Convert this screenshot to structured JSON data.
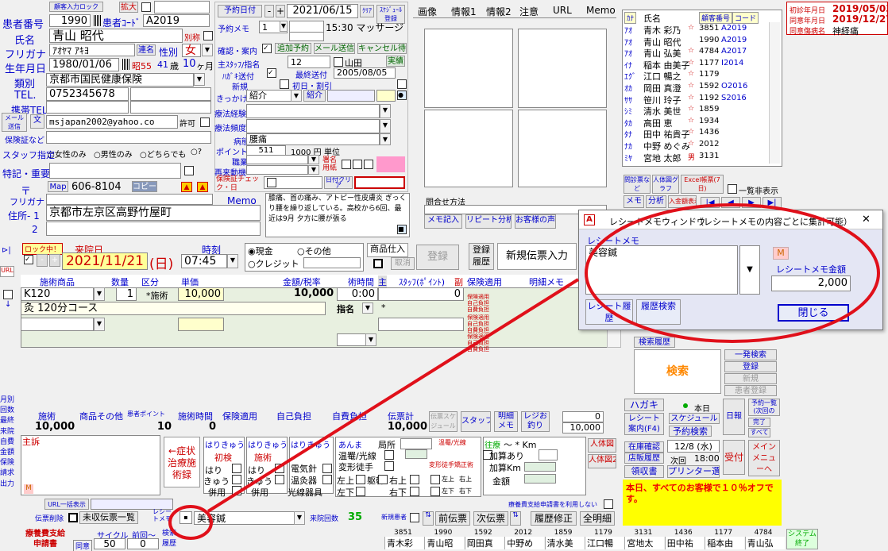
{
  "patient": {
    "lock_btn": "顧客入力ロック",
    "expand_btn": "拡大",
    "id_label": "患者番号",
    "id_value": "1990",
    "code_label": "患者ｺｰﾄﾞ",
    "code_value": "A2019",
    "name_label": "氏名",
    "name_value": "青山 昭代",
    "alias_label": "別称",
    "kana_label": "フリガナ",
    "kana_value": "ｱｵﾔﾏ ｱｷﾖ",
    "kana_btn": "連名",
    "sex_label": "性別",
    "sex_value": "女",
    "birth_label": "生年月日",
    "birth_value": "1980/01/06",
    "era_value": "昭55",
    "age_value": "41",
    "age_unit": "歳",
    "month_value": "10",
    "month_unit": "ヶ月",
    "category_label": "類別",
    "category_value": "京都市国民健康保険",
    "tel_label": "TEL.",
    "tel_value": "0752345678",
    "mobile_label": "携帯TEL",
    "mail_btn": "メール送信",
    "mail_btn2": "文",
    "email_value": "msjapan2002@yahoo.co",
    "permit_label": "許可",
    "insurance_label": "保険証など",
    "staff_label": "スタッフ指定",
    "staff_opt1": "女性のみ",
    "staff_opt2": "男性のみ",
    "staff_opt3": "どちらでも",
    "staff_opt4": "?",
    "notes_label": "特記・重要",
    "zip_label": "〒",
    "map_btn": "Map",
    "zip_value": "606-8104",
    "copy_btn": "コピー",
    "kana2_label": "フリガナ",
    "memo_label": "Memo",
    "addr1_label": "住所- 1",
    "addr1_value": "京都市左京区高野竹屋町",
    "addr2_label": "2"
  },
  "appt": {
    "date_btn": "予約日付",
    "minus": "-",
    "plus": "+",
    "date_value": "2021/06/15",
    "clear_btn": "ｸﾘｱ",
    "schedule_btn": "ｽｹｼﾞｭｰﾙ登録",
    "memo_label": "予約メモ",
    "memo_num": "1",
    "memo_text": "15:30 マッサージ",
    "confirm_label": "確認・案内",
    "mail_add_btn": "追加予約",
    "mail_send_btn": "メール送信",
    "cancel_btn": "キャンセル待",
    "main_staff_label": "主ｽﾀｯﾌ/指名",
    "main_staff_value": "12",
    "staff_name": "山田",
    "done_btn": "実績",
    "hagaki_label": "ﾊｶﾞｷ送付",
    "last_visit_label": "最終送付",
    "new_label": "新規",
    "last_visit_value": "2005/08/05",
    "first_label": "初日・割引",
    "trigger_label": "きっかけ",
    "trigger_value": "紹介",
    "intro_label": "紹介",
    "history_label": "療法経験",
    "freq_label": "療法頻度",
    "disease_label": "病態",
    "disease_value": "腰痛",
    "point_label": "ポイント",
    "point_value": "511",
    "point_yen": "1000 円",
    "point_unit": "単位",
    "job_label": "職業",
    "motive_label": "再来動機",
    "sign_label": "署名用紙",
    "insurance_check_label": "保険証チェック・日",
    "clear2_btn": "日付クリア",
    "memo_body": "膝痛、首の痛み、アトピー性皮膚炎 ぎっくり腰を繰り返している。高校から6回、最近は9月 夕方に腰が張る"
  },
  "tabs": [
    "画像",
    "情報1",
    "情報2",
    "注意",
    "URL",
    "Memo"
  ],
  "media": {
    "consult_label": "問合せ方法",
    "memo_btn": "メモ記入",
    "repeat_btn": "リピート分析",
    "voice_btn": "お客様の声"
  },
  "customer_list": {
    "kana_hdr": "ｶﾅ",
    "name_hdr": "氏名",
    "id_hdr": "顧客番号",
    "code_hdr": "コード",
    "rows": [
      {
        "kana": "ｱｵ",
        "name": "青木 彩乃",
        "star": "☆",
        "id": "3851",
        "code": "A2019"
      },
      {
        "kana": "ｱｵ",
        "name": "青山 昭代",
        "star": "",
        "id": "1990",
        "code": "A2019"
      },
      {
        "kana": "ｱｵ",
        "name": "青山 弘美",
        "star": "☆",
        "id": "4784",
        "code": "A2017"
      },
      {
        "kana": "ｲﾅ",
        "name": "稲本 由美子",
        "star": "☆",
        "id": "1177",
        "code": "I2014"
      },
      {
        "kana": "ｴｸﾞ",
        "name": "江口 暢之",
        "star": "☆",
        "id": "1179",
        "code": ""
      },
      {
        "kana": "ｵｶ",
        "name": "岡田 真澄",
        "star": "☆",
        "id": "1592",
        "code": "O2016"
      },
      {
        "kana": "ｻｻ",
        "name": "笹川 玲子",
        "star": "☆",
        "id": "1192",
        "code": "S2016"
      },
      {
        "kana": "ｼﾐ",
        "name": "清水 美世",
        "star": "☆",
        "id": "1859",
        "code": ""
      },
      {
        "kana": "ﾀｶ",
        "name": "高田 恵",
        "star": "☆",
        "id": "1934",
        "code": ""
      },
      {
        "kana": "ﾀﾅ",
        "name": "田中 祐貴子",
        "star": "☆",
        "id": "1436",
        "code": ""
      },
      {
        "kana": "ﾅｶ",
        "name": "中野 めぐみ",
        "star": "☆",
        "id": "2012",
        "code": ""
      },
      {
        "kana": "ﾐﾔ",
        "name": "宮地 太郎",
        "star": "男",
        "id": "3131",
        "code": ""
      }
    ]
  },
  "dates": {
    "first_label": "初診年月日",
    "first_value": "2019/05/03",
    "last_label": "同意年月日",
    "last_value": "2019/12/27",
    "consent_label": "同意傷病名",
    "consent_value": "神経痛"
  },
  "right_btns": {
    "symptom_btn": "問診票など",
    "body_btn": "人体図グラフ",
    "excel_btn": "Excel帳票(7日)",
    "list_label": "一覧非表示",
    "memo_btn": "メモ",
    "analysis_btn": "分析",
    "card_btn": "入金額表示",
    "nav_icons": [
      "|◀",
      "◀",
      "▶",
      "▶|"
    ]
  },
  "visit": {
    "lock_label": "ロック中！",
    "date_label": "来院日",
    "date_value": "2021/11/21",
    "dow": "(日)",
    "time_label": "時刻",
    "time_value": "07:45",
    "pay_cash": "現金",
    "pay_other": "その他",
    "pay_credit": "クレジット",
    "goods_btn": "商品仕入",
    "cancel_btn": "取消",
    "register_btn": "登録",
    "reg_history_btn": "登録履歴",
    "new_slip_btn": "新規伝票入力"
  },
  "table": {
    "headers": [
      "施術商品",
      "数量",
      "区分",
      "単価",
      "金額/税率",
      "術時間",
      "主",
      "ｽﾀｯﾌ(ﾎﾟｲﾝﾄ)",
      "副",
      "保険適用",
      "明細メモ"
    ],
    "rows": [
      {
        "item": "K120",
        "qty": "1",
        "kubun": "*施術",
        "price": "10,000",
        "amount": "10,000",
        "time": "0:00",
        "staff": "0"
      },
      {
        "item": "灸 120分コース",
        "qty": "",
        "kubun": "",
        "price": "",
        "amount": "",
        "time": "指名",
        "staff": "*"
      }
    ],
    "ins_labels": [
      "保険適用",
      "自己負担",
      "自費負担"
    ]
  },
  "totals": {
    "headers": [
      "施術",
      "商品その他",
      "患者ポイント",
      "施術時間",
      "保険適用",
      "自己負担",
      "自費負担",
      "伝票計"
    ],
    "values": [
      "10,000",
      "",
      "10",
      "0",
      "",
      "",
      "",
      "10,000"
    ],
    "sched_btn": "伝票スケジュール",
    "staff_btn": "スタッフ",
    "memo_btn": "明細メモ",
    "reg_btn": "レジお釣り",
    "change_value": "0",
    "paid_value": "10,000"
  },
  "lower": {
    "main_label": "主訴",
    "symptom_btn": "←症状治療施術録",
    "hari1": "はりきゅう",
    "first": "初検",
    "hari": "はり",
    "kyu": "きゅう",
    "combo": "併用",
    "hari2": "はりきゅう",
    "treat": "施術",
    "hari3": "はりきゅう",
    "elec": "電気針",
    "warm": "温灸器",
    "light": "光線器具",
    "amma": "あんま",
    "local": "局所",
    "warm2": "温罨/光線",
    "deform": "変形徒手",
    "warm3": "温罨/光線",
    "deform2": "変形徒手矯正術",
    "left_up": "左上",
    "trunk": "躯幹",
    "right_up": "右上",
    "left_down": "左下",
    "right_down": "右下",
    "visit_label": "往療",
    "km": "～ * Km",
    "add1": "加算あり",
    "add_km": "加算Km",
    "money": "金額",
    "body1": "人体図",
    "body2": "人体図2",
    "url_btn": "URL一括表示",
    "delete_label": "伝票削除",
    "unpaid_btn": "未収伝票一覧",
    "receipt_label": "レシートメモ",
    "receipt_value": "美容鍼",
    "visit_count_label": "来院回数",
    "visit_count": "35",
    "new_patient_label": "新規患者",
    "prev_btn": "前伝票",
    "next_btn": "次伝票",
    "hist_btn": "履歴修正",
    "all_btn": "全明細",
    "no_insurance": "療養費支給申請書を利用しない",
    "cycle_label": "サイクル",
    "prev_label": "前回～",
    "cycle_value": "50",
    "prev_value": "0",
    "bottom_label1": "療養費支給申請書",
    "bottom_label2": "同意",
    "search_label": "検索履歴",
    "sys_btn": "システム終了"
  },
  "right_lower": {
    "search_hist_btn": "検索履歴",
    "search_btn": "検索",
    "one_search": "一発検索",
    "register": "登録",
    "new_btn": "新規",
    "info_btn": "患者登録",
    "hagaki_btn": "ハガキ",
    "receipt_btn": "レシート案内(F4)",
    "today_label": "本日",
    "schedule_btn": "スケジュール",
    "booking_btn": "予約検索",
    "day_btn": "日報",
    "list_btn": "予約一覧(次回のみ)",
    "done_btn": "完了",
    "all_btn": "すべて",
    "stock_btn": "在庫確認",
    "store_btn": "店販履歴",
    "next_date": "12/8 (水)",
    "next_label": "次回",
    "next_time": "18:00",
    "reception_btn": "受付",
    "menu_btn": "メインメニューへ",
    "receipt2_btn": "領収書",
    "printer_btn": "プリンター選択",
    "notice": "本日、すべてのお客様で１０％オフです。"
  },
  "left_side": [
    "月別",
    "回数",
    "最終",
    "来院",
    "自費",
    "金額",
    "保険",
    "請求",
    "出力"
  ],
  "left_top": [
    "URL"
  ],
  "bottom_names": [
    "3851 青木 彩",
    "1990 青山 昭",
    "1592 岡田 真",
    "2012 中野 め",
    "1859 清水 美",
    "1179 江口 暢",
    "3131 宮地 太",
    "1436 田中 祐",
    "1177 稲本 由",
    "4784 青山 弘"
  ],
  "popup": {
    "icon": "A",
    "title": "レシートメモウィンドウ",
    "subtitle": "（レシートメモの内容ごとに集計可能）",
    "close": "✕",
    "memo_label": "レシートメモ",
    "memo_value": "美容鍼",
    "m_btn": "M",
    "amount_label": "レシートメモ金額",
    "amount_value": "2,000",
    "receipt_hist_btn": "レシート履歴",
    "hist_search_btn": "履歴検索",
    "close_btn": "閉じる"
  },
  "colors": {
    "annotation": "#e0101a",
    "label_blue": "#0000cc",
    "notice_bg": "#ffff00",
    "date_bg": "#ffff99"
  }
}
